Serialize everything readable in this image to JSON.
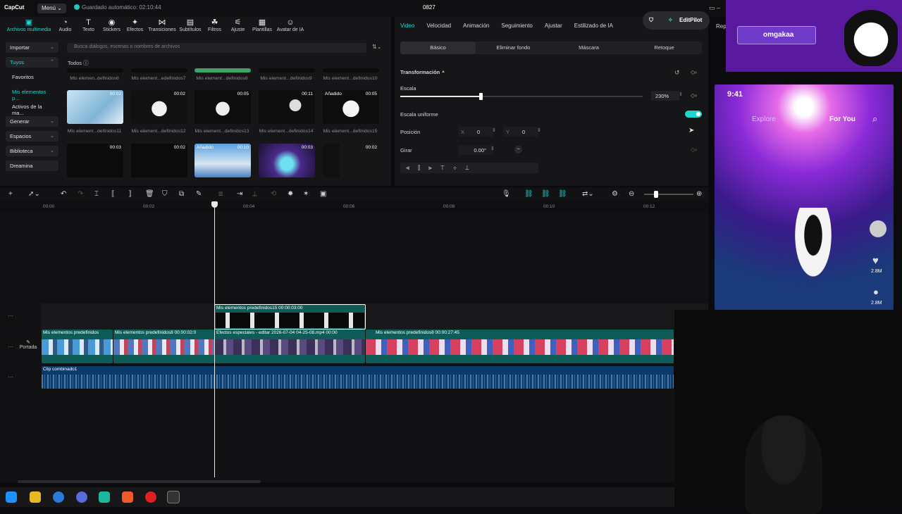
{
  "app": {
    "logo": "CapCut",
    "menu": "Menú",
    "autosave": "Guardado automático: 02:10:44",
    "project": "0827"
  },
  "toolbar": [
    {
      "label": "Archivos multimedia",
      "icon": "media-icon",
      "active": true
    },
    {
      "label": "Audio",
      "icon": "audio-icon"
    },
    {
      "label": "Texto",
      "icon": "text-icon"
    },
    {
      "label": "Stickers",
      "icon": "sticker-icon"
    },
    {
      "label": "Efectos",
      "icon": "effects-icon"
    },
    {
      "label": "Transiciones",
      "icon": "transition-icon"
    },
    {
      "label": "Subtítulos",
      "icon": "subtitles-icon"
    },
    {
      "label": "Filtros",
      "icon": "filter-icon"
    },
    {
      "label": "Ajuste",
      "icon": "adjust-icon"
    },
    {
      "label": "Plantillas",
      "icon": "template-icon"
    },
    {
      "label": "Avatar de IA",
      "icon": "avatar-icon"
    }
  ],
  "sidenav": [
    "Importar",
    "Tuyos",
    "Favoritos",
    "Mis elementos p...",
    "Activos de la ma...",
    "Generar",
    "Espacios",
    "Biblioteca",
    "Dreamina"
  ],
  "search_placeholder": "Busca diálogos, escenas o nombres de archivos",
  "todos": "Todos",
  "row0_labels": [
    "Mis elemen..definidos6",
    "Mis element...edefinidos7",
    "Mis element...definidos8",
    "Mis element...definidos9",
    "Mis element...definidos10"
  ],
  "row1": [
    {
      "label": "Mis element...definidos11",
      "badge": "00:02"
    },
    {
      "label": "Mis element...definidos12",
      "badge": "00:02"
    },
    {
      "label": "Mis element...definidos13",
      "badge": "00:05"
    },
    {
      "label": "Mis element...definidos14",
      "badge": "00:11"
    },
    {
      "label": "Mis element...definidos15",
      "badge": "00:05",
      "added": "Añadido"
    }
  ],
  "row2": [
    {
      "badge": "00:03"
    },
    {
      "badge": "00:02"
    },
    {
      "badge": "00:10",
      "added": "Añadido"
    },
    {
      "badge": "00:03"
    },
    {
      "badge": "00:02"
    }
  ],
  "props": {
    "tabs": [
      "Video",
      "Velocidad",
      "Animación",
      "Seguimiento",
      "Ajustar",
      "Estilizado de IA"
    ],
    "editpilot": "EditPilot",
    "rep": "Rep",
    "subtabs": [
      "Básico",
      "Eliminar fondo",
      "Máscara",
      "Retoque"
    ],
    "transform": "Transformación",
    "scale_label": "Escala",
    "scale_value": "230%",
    "scale_fraction": 0.33,
    "uniform": "Escala uniforme",
    "position_label": "Posición",
    "pos_x_label": "X",
    "pos_x": "0",
    "pos_y_label": "Y",
    "pos_y": "0",
    "rotate_label": "Girar",
    "rotate_value": "0.00°"
  },
  "ruler": [
    "00:00",
    "00:02",
    "00:04",
    "00:06",
    "00:08",
    "00:10",
    "00:12"
  ],
  "tracks": {
    "overlay_clip": "Mis elementos predefinidos15   00:00:03:00",
    "main_clips": [
      "Mis elementos predefinidos",
      "Mis elementos predefinidos8  00:00:02:0",
      "Efectos especiales - editar   2026-07-04 04-25-08.mp4   00:00",
      "Mis elementos predefinidos8   00:00:27:45"
    ],
    "cover": "Portada",
    "audio_clip": "Clip combinado1"
  },
  "stream": {
    "username": "omgakaa"
  },
  "phone": {
    "time": "9:41",
    "explore": "Explore",
    "foryou": "For You",
    "likes": "2.8M",
    "comments": "2.8M"
  },
  "colors": {
    "accent": "#1fd6cf",
    "panel": "#161618",
    "timeline": "#111113"
  }
}
